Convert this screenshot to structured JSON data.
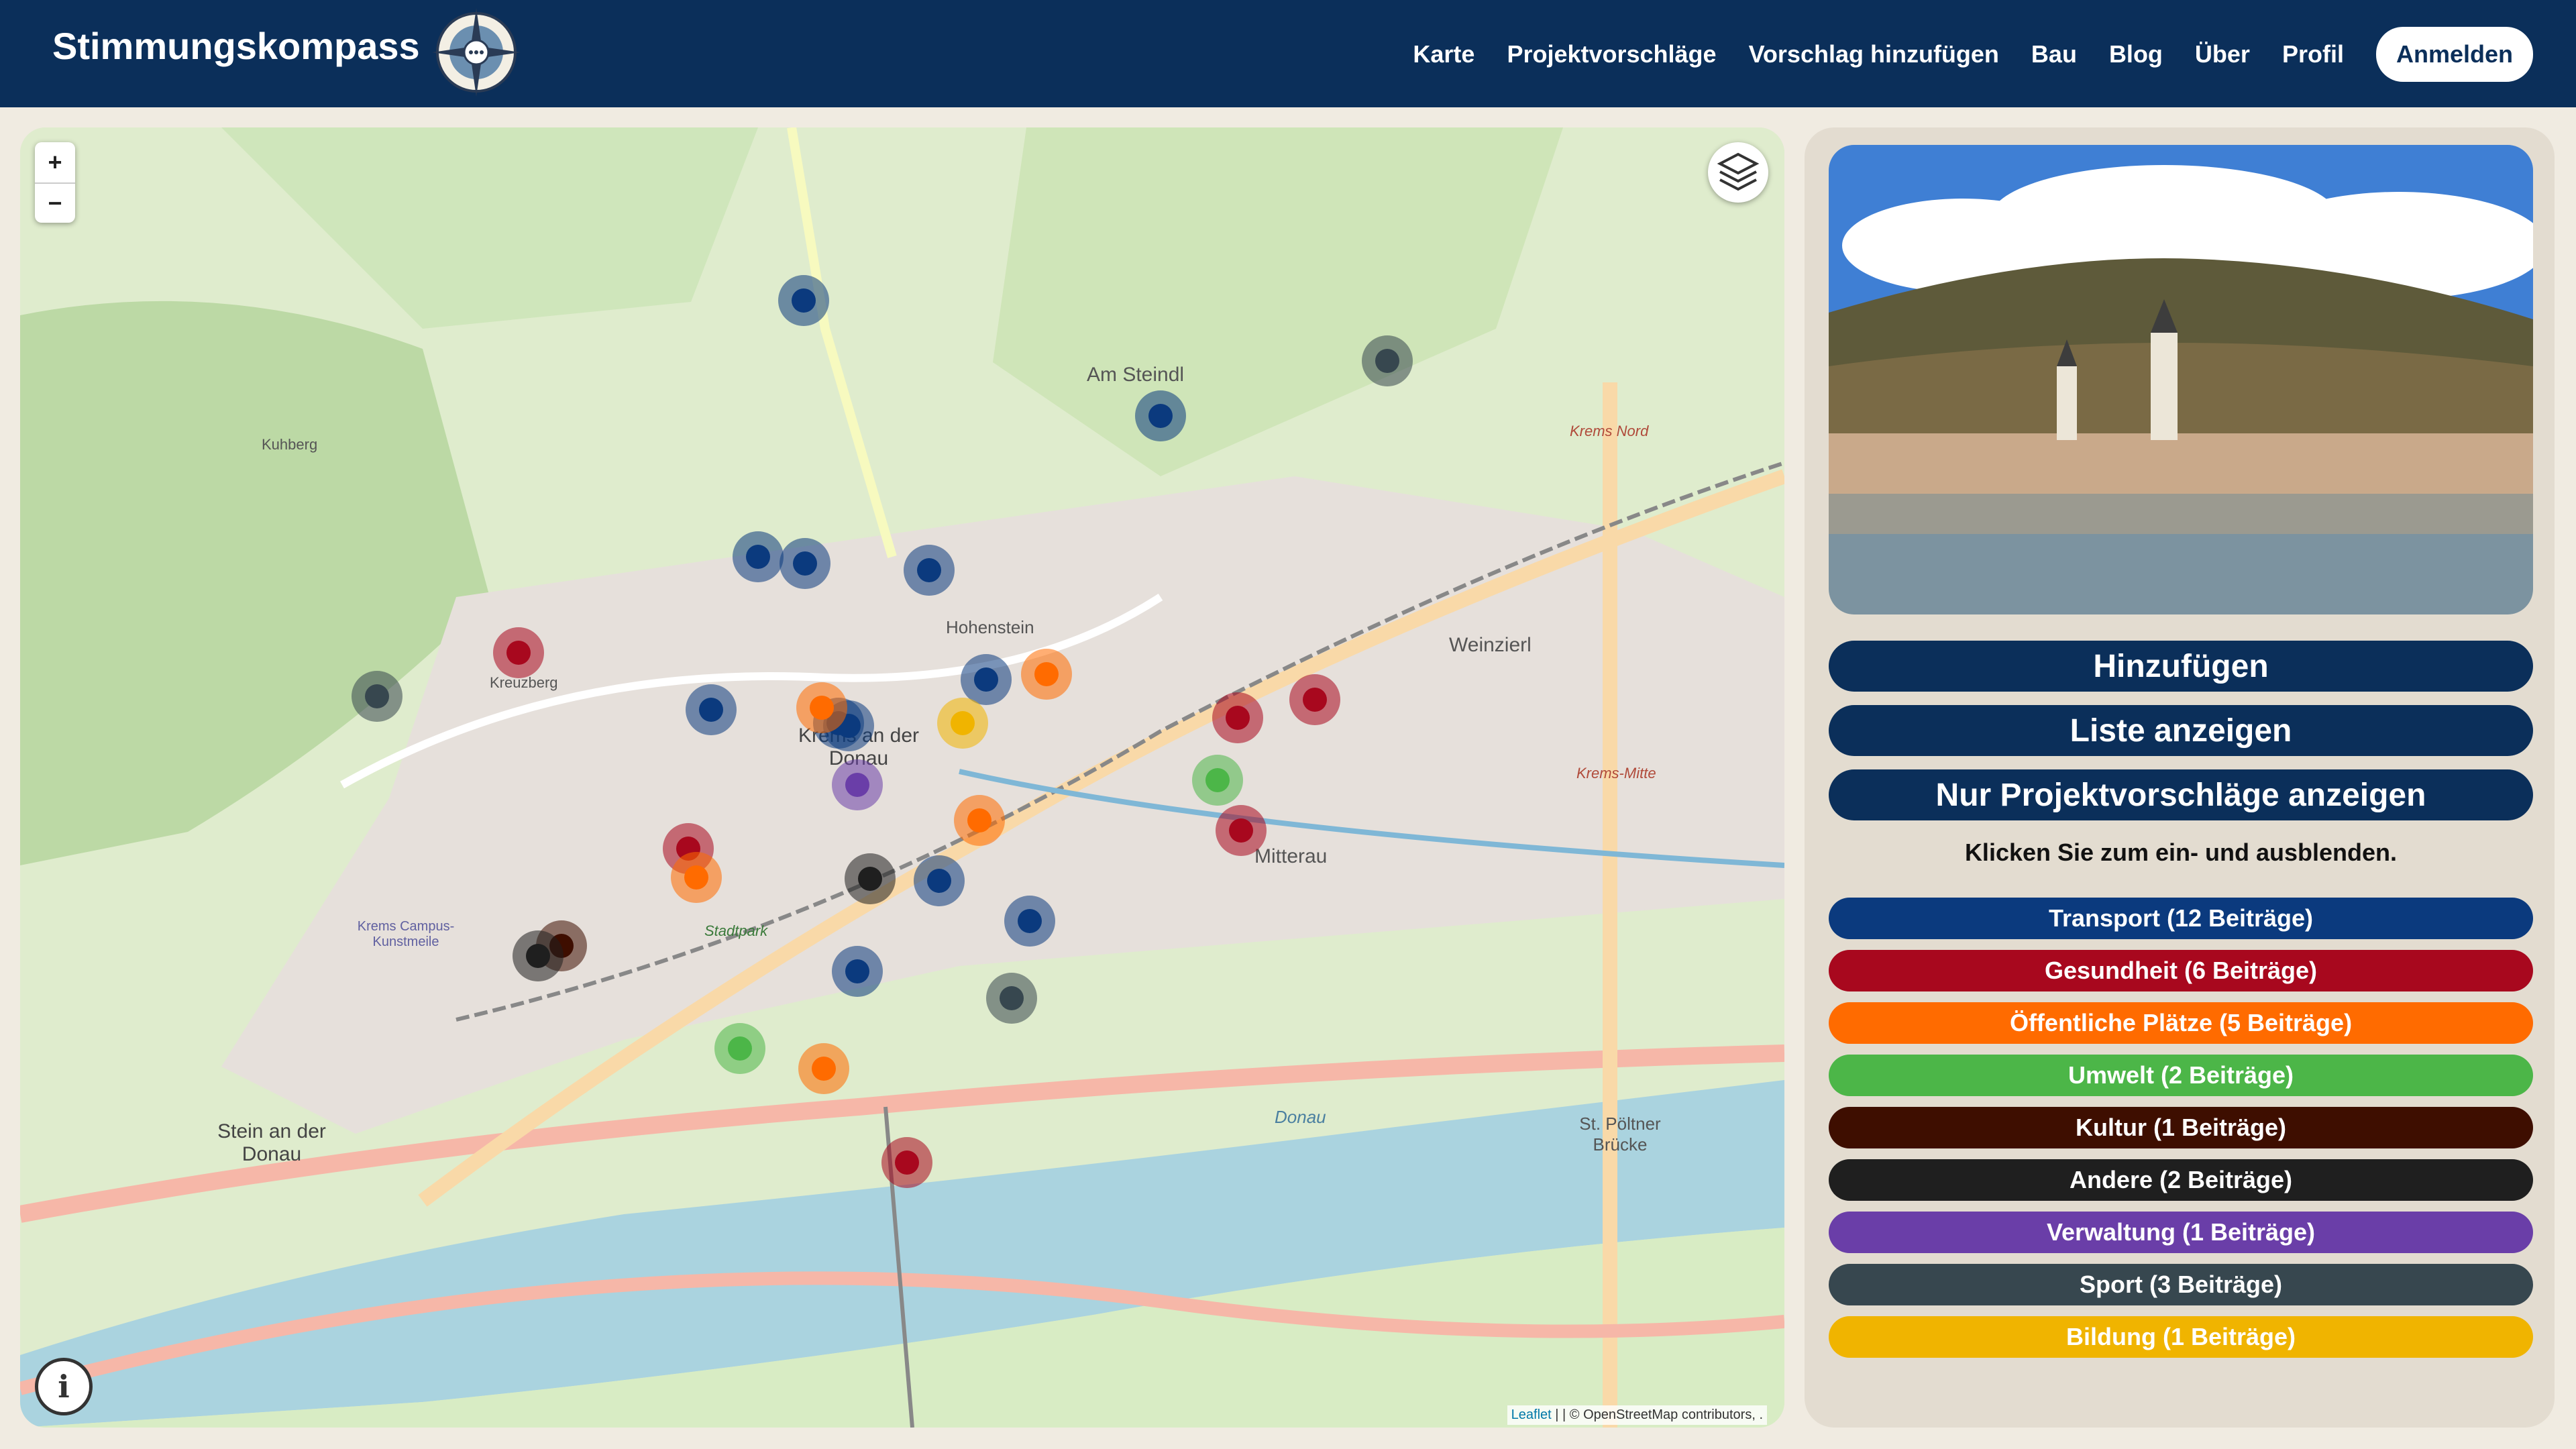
{
  "header": {
    "brand": "Stimmungskompass",
    "nav": [
      "Karte",
      "Projektvorschläge",
      "Vorschlag hinzufügen",
      "Bau",
      "Blog",
      "Über",
      "Profil"
    ],
    "login": "Anmelden"
  },
  "map": {
    "zoom_in": "+",
    "zoom_out": "−",
    "info": "i",
    "attribution_link": "Leaflet",
    "attribution_text": " | | © OpenStreetMap contributors, ."
  },
  "map_labels": {
    "krems": "Krems an der Donau",
    "stein": "Stein an der Donau",
    "mitterau": "Mitterau",
    "weinzierl": "Weinzierl",
    "am_steindl": "Am Steindl",
    "hohenstein": "Hohenstein",
    "donau": "Donau",
    "stpoltner": "St. Pöltner Brücke",
    "krems_nord": "Krems Nord",
    "krems_mitte": "Krems-Mitte",
    "kuhberg": "Kuhberg",
    "kreuzberg": "Kreuzberg",
    "stadtpark": "Stadtpark",
    "campus": "Krems Campus-Kunstmeile"
  },
  "colors": {
    "transport": "#0b3a7e",
    "gesundheit": "#a8081e",
    "oeffentlich": "#ff6b00",
    "umwelt": "#4cb648",
    "kultur": "#3e0e00",
    "andere": "#1f1f1f",
    "verwaltung": "#6a3ea8",
    "sport": "#37474f",
    "bildung": "#f0b400"
  },
  "panel": {
    "buttons": [
      "Hinzufügen",
      "Liste anzeigen",
      "Nur Projektvorschläge anzeigen"
    ],
    "hint": "Klicken Sie zum ein- und ausblenden.",
    "categories": [
      {
        "label": "Transport (12 Beiträge)",
        "color": "#0b3a7e"
      },
      {
        "label": "Gesundheit (6 Beiträge)",
        "color": "#a8081e"
      },
      {
        "label": "Öffentliche Plätze (5 Beiträge)",
        "color": "#ff6b00"
      },
      {
        "label": "Umwelt (2 Beiträge)",
        "color": "#4cb648"
      },
      {
        "label": "Kultur (1 Beiträge)",
        "color": "#3e0e00"
      },
      {
        "label": "Andere (2 Beiträge)",
        "color": "#1f1f1f"
      },
      {
        "label": "Verwaltung (1 Beiträge)",
        "color": "#6a3ea8"
      },
      {
        "label": "Sport (3 Beiträge)",
        "color": "#37474f"
      },
      {
        "label": "Bildung (1 Beiträge)",
        "color": "#f0b400"
      }
    ]
  }
}
